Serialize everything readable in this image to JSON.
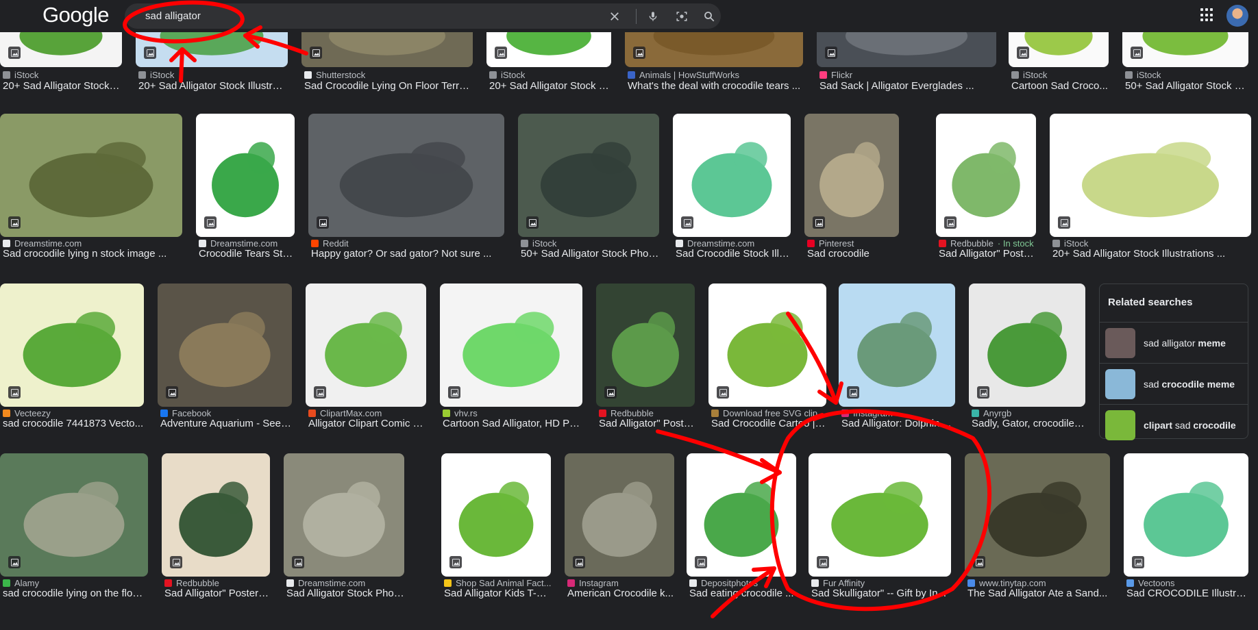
{
  "header": {
    "logo_text": "Google",
    "search_value": "sad alligator"
  },
  "rows": [
    [
      {
        "source": "iStock",
        "title": "20+ Sad Alligator Stock I...",
        "fav": "#8e9196",
        "bg": "#f4f4f4",
        "fg": "#58a33a"
      },
      {
        "source": "iStock",
        "title": "20+ Sad Alligator Stock Illustrati...",
        "fav": "#8e9196",
        "bg": "#c5ddf0",
        "fg": "#5aa85a"
      },
      {
        "source": "Shutterstock",
        "title": "Sad Crocodile Lying On Floor Terrari...",
        "fav": "#e8eaed",
        "bg": "#6f6a55",
        "fg": "#8b8466"
      },
      {
        "source": "iStock",
        "title": "20+ Sad Alligator Stock Il...",
        "fav": "#8e9196",
        "bg": "#ffffff",
        "fg": "#56b543"
      },
      {
        "source": "Animals | HowStuffWorks",
        "title": "What's the deal with crocodile tears ...",
        "fav": "#3a64c8",
        "bg": "#8a6a3a",
        "fg": "#7a5a2a"
      },
      {
        "source": "Flickr",
        "title": "Sad Sack | Alligator Everglades ...",
        "fav": "#ff3d7f",
        "bg": "#4a4f56",
        "fg": "#6a6f76"
      },
      {
        "source": "iStock",
        "title": "Cartoon Sad Croco...",
        "fav": "#8e9196",
        "bg": "#fafafa",
        "fg": "#9cc94a"
      },
      {
        "source": "iStock",
        "title": "50+ Sad Alligator Stock P...",
        "fav": "#8e9196",
        "bg": "#fafafa",
        "fg": "#7bbd3f"
      }
    ],
    [
      {
        "source": "Dreamstime.com",
        "title": "Sad crocodile lying n stock image ...",
        "fav": "#e8eaed",
        "bg": "#8a9a66",
        "fg": "#5e6a3a"
      },
      {
        "source": "Dreamstime.com",
        "title": "Crocodile Tears Sto...",
        "fav": "#e8eaed",
        "bg": "#ffffff",
        "fg": "#3aa84a"
      },
      {
        "source": "Reddit",
        "title": "Happy gator? Or sad gator? Not sure ...",
        "fav": "#ff4500",
        "bg": "#5e6266",
        "fg": "#44484c"
      },
      {
        "source": "iStock",
        "title": "50+ Sad Alligator Stock Phot...",
        "fav": "#8e9196",
        "bg": "#4c5a4e",
        "fg": "#33403a"
      },
      {
        "source": "Dreamstime.com",
        "title": "Sad Crocodile Stock Illu...",
        "fav": "#e8eaed",
        "bg": "#ffffff",
        "fg": "#5cc795"
      },
      {
        "source": "Pinterest",
        "title": "Sad crocodile",
        "fav": "#e60023",
        "bg": "#7a7565",
        "fg": "#b3a88a"
      },
      {
        "source": "Redbubble",
        "stock": "In stock",
        "title": "Sad Alligator\" Poste...",
        "fav": "#e41321",
        "bg": "#ffffff",
        "fg": "#7fb86a"
      },
      {
        "source": "iStock",
        "title": "20+ Sad Alligator Stock Illustrations ...",
        "fav": "#8e9196",
        "bg": "#ffffff",
        "fg": "#c8d88a"
      }
    ],
    [
      {
        "source": "Vecteezy",
        "title": "sad crocodile 7441873 Vecto...",
        "fav": "#f38a1e",
        "bg": "#eef1cc",
        "fg": "#5aaa3a"
      },
      {
        "source": "Facebook",
        "title": "Adventure Aquarium - See y...",
        "fav": "#1877f2",
        "bg": "#5a5448",
        "fg": "#8a7a5a"
      },
      {
        "source": "ClipartMax.com",
        "title": "Alligator Clipart Comic - ...",
        "fav": "#e84b1e",
        "bg": "#f0f0f0",
        "fg": "#6ab84a"
      },
      {
        "source": "vhv.rs",
        "title": "Cartoon Sad Alligator, HD Png...",
        "fav": "#9acd32",
        "bg": "#f4f4f4",
        "fg": "#6fd86a"
      },
      {
        "source": "Redbubble",
        "title": "Sad Alligator\" Poste...",
        "fav": "#e41321",
        "bg": "#334433",
        "fg": "#5c9a4a"
      },
      {
        "source": "Download free SVG clip...",
        "title": "Sad Crocodile Cartoo | ...",
        "fav": "#a87f3a",
        "bg": "#ffffff",
        "fg": "#7ab83a"
      },
      {
        "source": "Instagram",
        "title": "Sad Alligator: Dolphin ...",
        "fav": "#d62976",
        "bg": "#b9dbf2",
        "fg": "#6a9a7a"
      },
      {
        "source": "Anyrgb",
        "title": "Sadly, Gator, crocodiles,...",
        "fav": "#3ab5a8",
        "bg": "#e8e8e8",
        "fg": "#4a9a3a"
      }
    ],
    [
      {
        "source": "Alamy",
        "title": "sad crocodile lying on the floor...",
        "fav": "#3bb54a",
        "bg": "#5a7a5a",
        "fg": "#9aa08a"
      },
      {
        "source": "Redbubble",
        "title": "Sad Alligator\" Poster f...",
        "fav": "#e41321",
        "bg": "#e8dcc8",
        "fg": "#3a5a3a"
      },
      {
        "source": "Dreamstime.com",
        "title": "Sad Alligator Stock Photos - F...",
        "fav": "#e8eaed",
        "bg": "#8a8a7a",
        "fg": "#b0b0a0"
      },
      {
        "source": "Shop Sad Animal Fact...",
        "title": "Sad Alligator Kids T-S...",
        "fav": "#f5c518",
        "bg": "#ffffff",
        "fg": "#6ab83a"
      },
      {
        "source": "Instagram",
        "title": "American Crocodile k...",
        "fav": "#d62976",
        "bg": "#6a6a5a",
        "fg": "#9a9a8a"
      },
      {
        "source": "Depositphotos",
        "title": "Sad eating crocodile ...",
        "fav": "#e8eaed",
        "bg": "#ffffff",
        "fg": "#4aa84a"
      },
      {
        "source": "Fur Affinity",
        "title": "Sad Skulligator\" -- Gift by In...",
        "fav": "#e8eaed",
        "bg": "#ffffff",
        "fg": "#6ab83a"
      },
      {
        "source": "www.tinytap.com",
        "title": "The Sad Alligator Ate a Sand...",
        "fav": "#4a8ae8",
        "bg": "#6a6a55",
        "fg": "#3a3a2a"
      },
      {
        "source": "Vectoons",
        "title": "Sad CROCODILE Illustrati...",
        "fav": "#5a9ae8",
        "bg": "#ffffff",
        "fg": "#5cc795"
      }
    ]
  ],
  "related": {
    "title": "Related searches",
    "items": [
      {
        "pre": "sad alligator ",
        "bold": "meme",
        "color": "#6a5a5a"
      },
      {
        "pre": "sad ",
        "bold": "crocodile meme",
        "color": "#8ab8d8"
      },
      {
        "pre": "",
        "bold": "clipart",
        "mid": " sad ",
        "bold2": "crocodile",
        "color": "#7ab83a"
      }
    ]
  },
  "icons": {
    "clear": "close-icon",
    "mic": "microphone-icon",
    "lens": "camera-search-icon",
    "search": "search-icon",
    "apps": "apps-grid-icon"
  }
}
